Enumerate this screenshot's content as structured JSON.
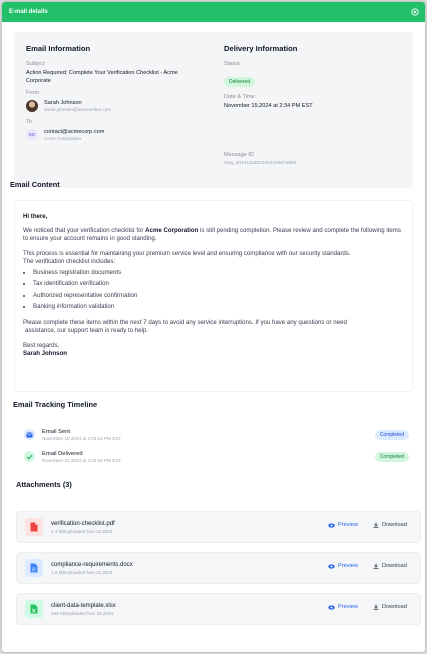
{
  "header": {
    "title": "E-mail details"
  },
  "email_info": {
    "heading": "Email Information",
    "subject_label": "Subject",
    "subject_line1": "Action Required: Complete Your Verification Checklist - Acme",
    "subject_line2": "Corporate",
    "from_label": "From",
    "from_name": "Sarah Johnson",
    "from_email": "sarah.johnson@acmeonline.com",
    "to_label": "To",
    "to_initials": "AC",
    "to_email": "contact@acmecorp.com",
    "to_company": "Acme Corporation"
  },
  "delivery_info": {
    "heading": "Delivery Information",
    "status_label": "Status",
    "status_value": "Delivered",
    "datetime_label": "Date & Time",
    "datetime_value": "November 15,2024 at 2:34 PM EST",
    "message_id_label": "Message ID",
    "message_id_value": "msg_20241115023412345673890"
  },
  "content": {
    "heading": "Email Content",
    "greeting": "Hi there,",
    "para1_pre": "We noticed that your verification checklist for ",
    "para1_bold": "Acme Corporation",
    "para1_post": " is still pending completion. Please review and complete the following items to ensure your account remains in good standing.",
    "para2_line1": "This process is essential for maintaining your premium service level and ensuring compliance with our security standards.",
    "para2_line2": "The verification checklist includes:",
    "items": [
      "Business registration documents",
      "Tax identification verification",
      "Authorized representative confirmation",
      "Banking information validation"
    ],
    "para3_line1": "Please complete these items within the next 7 days to avoid any service interruptions. If you have any questions or need",
    "para3_line2": "assistance, our support team is ready to help.",
    "closing": "Best regards,",
    "signature": "Sarah Johnson"
  },
  "timeline": {
    "heading": "Email Tracking Timeline",
    "events": [
      {
        "title": "Email Sent",
        "time": "November 15,2024 at 2:34:12 PM EST",
        "status": "Completed"
      },
      {
        "title": "Email Delivered",
        "time": "November 15,2024 at 2:34:18 PM EST",
        "status": "Completed"
      }
    ]
  },
  "attachments": {
    "heading": "Attachments (3)",
    "preview_label": "Preview",
    "download_label": "Download",
    "files": [
      {
        "name": "verification-checklist.pdf",
        "meta": "2.4 MBUploaded Nov 15,2024",
        "icon": "pdf-file-icon"
      },
      {
        "name": "compliance-requirements.docx",
        "meta": "1.8 MBUploaded Nov 15,2024",
        "icon": "doc-file-icon"
      },
      {
        "name": "client-data-template.xlsx",
        "meta": "456 KBUploaded Nov 15,2024",
        "icon": "xls-file-icon"
      }
    ]
  },
  "colors": {
    "accent": "#22c06a",
    "link": "#2563eb",
    "pdf": "#ef4444",
    "doc": "#3b82f6",
    "xls": "#22c55e"
  }
}
